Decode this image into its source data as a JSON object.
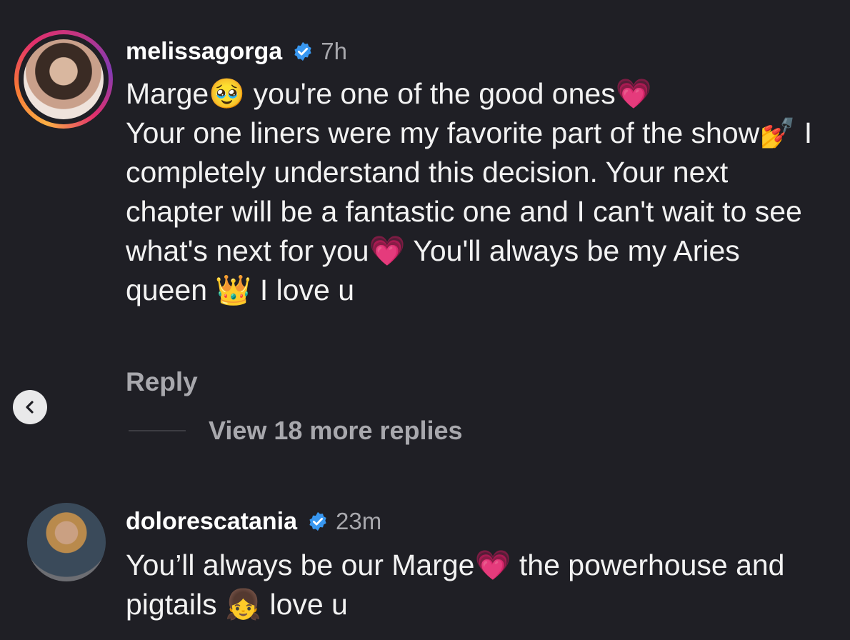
{
  "comments": [
    {
      "username": "melissagorga",
      "time": "7h",
      "text": "Marge🥹 you're one of the good ones💗\nYour one liners were my favorite part of the show💅 I completely understand this decision. Your next chapter will be a fantastic one and I can't wait to see what's next for you💗 You'll always be my Aries queen 👑 I love u",
      "reply_label": "Reply",
      "view_more_label": "View 18 more replies"
    },
    {
      "username": "dolorescatania",
      "time": "23m",
      "text": "You’ll always be our Marge💗 the powerhouse and pigtails 👧 love u"
    }
  ],
  "colors": {
    "background": "#1f1f25",
    "verified_badge": "#3897f0",
    "muted_text": "#a8a8ad"
  },
  "icons": {
    "verified": "verified-badge-icon",
    "back": "chevron-left-icon"
  }
}
